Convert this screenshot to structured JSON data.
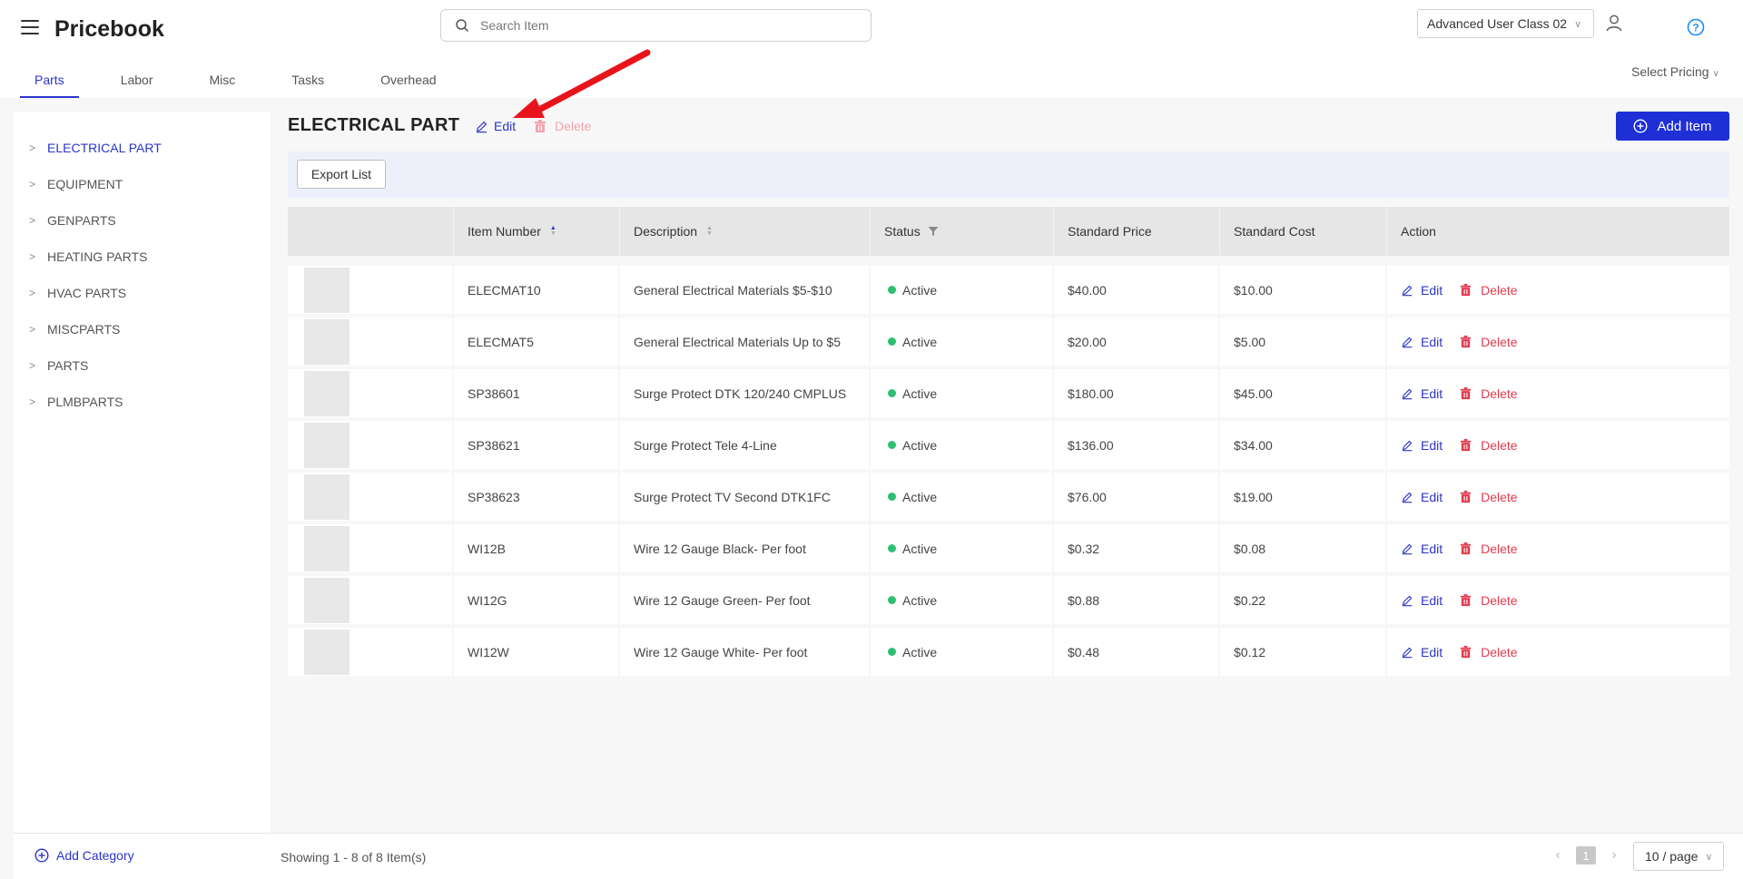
{
  "header": {
    "title": "Pricebook",
    "search_placeholder": "Search Item",
    "user_class": "Advanced User Class 02",
    "select_pricing": "Select Pricing"
  },
  "tabs": [
    {
      "label": "Parts",
      "active": true
    },
    {
      "label": "Labor"
    },
    {
      "label": "Misc"
    },
    {
      "label": "Tasks"
    },
    {
      "label": "Overhead"
    }
  ],
  "sidebar": {
    "categories": [
      {
        "label": "ELECTRICAL PART",
        "active": true
      },
      {
        "label": "EQUIPMENT"
      },
      {
        "label": "GENPARTS"
      },
      {
        "label": "HEATING PARTS"
      },
      {
        "label": "HVAC PARTS"
      },
      {
        "label": "MISCPARTS"
      },
      {
        "label": "PARTS"
      },
      {
        "label": "PLMBPARTS"
      }
    ],
    "add_category": "Add Category"
  },
  "main": {
    "title": "ELECTRICAL PART",
    "edit_label": "Edit",
    "delete_label": "Delete",
    "add_item_label": "Add Item",
    "export_label": "Export List"
  },
  "table": {
    "columns": [
      "",
      "Item Number",
      "Description",
      "Status",
      "Standard Price",
      "Standard Cost",
      "Action"
    ],
    "edit_label": "Edit",
    "delete_label": "Delete",
    "rows": [
      {
        "item": "ELECMAT10",
        "desc": "General Electrical Materials $5-$10",
        "status": "Active",
        "price": "$40.00",
        "cost": "$10.00"
      },
      {
        "item": "ELECMAT5",
        "desc": "General Electrical Materials Up to $5",
        "status": "Active",
        "price": "$20.00",
        "cost": "$5.00"
      },
      {
        "item": "SP38601",
        "desc": "Surge Protect DTK 120/240 CMPLUS",
        "status": "Active",
        "price": "$180.00",
        "cost": "$45.00"
      },
      {
        "item": "SP38621",
        "desc": "Surge Protect Tele 4-Line",
        "status": "Active",
        "price": "$136.00",
        "cost": "$34.00"
      },
      {
        "item": "SP38623",
        "desc": "Surge Protect TV Second DTK1FC",
        "status": "Active",
        "price": "$76.00",
        "cost": "$19.00"
      },
      {
        "item": "WI12B",
        "desc": "Wire 12 Gauge Black- Per foot",
        "status": "Active",
        "price": "$0.32",
        "cost": "$0.08"
      },
      {
        "item": "WI12G",
        "desc": "Wire 12 Gauge Green- Per foot",
        "status": "Active",
        "price": "$0.88",
        "cost": "$0.22"
      },
      {
        "item": "WI12W",
        "desc": "Wire 12 Gauge White- Per foot",
        "status": "Active",
        "price": "$0.48",
        "cost": "$0.12"
      }
    ]
  },
  "footer": {
    "showing": "Showing 1 - 8 of 8 Item(s)",
    "current_page": "1",
    "per_page": "10 / page"
  },
  "colors": {
    "accent": "#2b35c9",
    "primary_button": "#1e2fd6",
    "danger": "#e23b4e",
    "active_status": "#2fbf71",
    "annotation_arrow": "#e8141c"
  },
  "icons": [
    "hamburger-icon",
    "search-icon",
    "user-icon",
    "help-icon",
    "edit-icon",
    "trash-icon",
    "plus-circle-icon",
    "sort-icon",
    "filter-icon",
    "chevron-right-icon",
    "chevron-down-icon"
  ]
}
